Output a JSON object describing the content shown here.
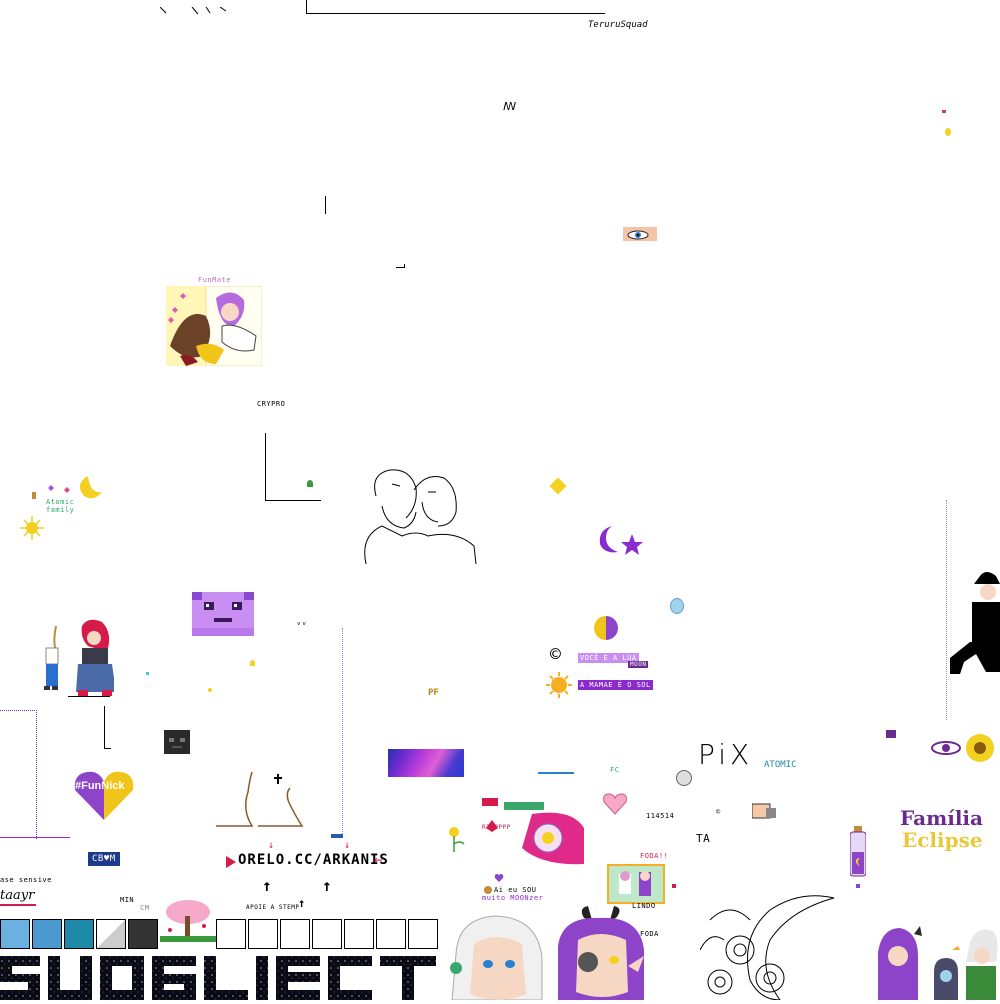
{
  "canvas": {
    "labels": {
      "teruru": "TeruruSquad",
      "funmate": "FunMate",
      "crypro": "CRYPRO",
      "atomic_family": "Atomic family",
      "funnick": "#FunNick",
      "pix": "PiX",
      "atomic": "ATOMIC",
      "familia": "Família",
      "eclipse": "Eclipse",
      "orelo": "ORELO.CC/ARKANIS",
      "apoie": "APOIE A STEMP",
      "cbm": "CB♥M",
      "voce_lua": "VOCÊ É A LUA",
      "mamaeer": "A MAMAE É O SOL",
      "aieusou": "Ai eu SOU",
      "muitomoon": "muito MOONzer",
      "base_sensive": "ase sensive",
      "taayr": "taayr",
      "min": "MIN",
      "rip": "RIPPPPP",
      "pf": "PF",
      "fc": "FC",
      "ta": "TA",
      "lindo": "LINDO",
      "foda": "FODA",
      "foda2": "FODA!!",
      "num": "114514",
      "moon": "MOON",
      "cm": "CM"
    },
    "colors": {
      "purple": "#8a2bd0",
      "lavender": "#c98ef2",
      "gold": "#f4d020",
      "heart_purple": "#8e44c9",
      "heart_yellow": "#f0c419",
      "familia_purple": "#6a2a8e",
      "eclipse_yellow": "#e9c93a",
      "red": "#d6162a",
      "teal": "#1e8aa8"
    }
  }
}
